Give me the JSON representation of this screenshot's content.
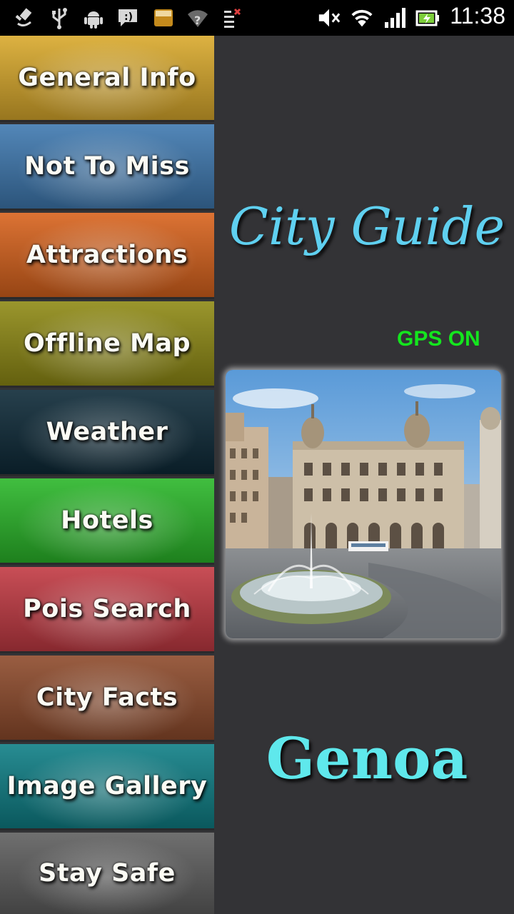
{
  "status_bar": {
    "time": "11:38",
    "left_icons": [
      "satellite-icon",
      "usb-icon",
      "android-icon",
      "message-icon",
      "amazon-apps-icon",
      "wifi-question-icon",
      "task-list-icon"
    ],
    "right_icons": [
      "mute-icon",
      "wifi-icon",
      "signal-icon",
      "battery-charging-icon"
    ]
  },
  "menu": {
    "items": [
      {
        "label": "General Info",
        "color": "#d9a92c"
      },
      {
        "label": "Not To Miss",
        "color": "#3f79b0"
      },
      {
        "label": "Attractions",
        "color": "#d8631d"
      },
      {
        "label": "Offline Map",
        "color": "#8f8a15"
      },
      {
        "label": "Weather",
        "color": "#0e2a38"
      },
      {
        "label": "Hotels",
        "color": "#2bb72a"
      },
      {
        "label": "Pois Search",
        "color": "#c23a43"
      },
      {
        "label": "City Facts",
        "color": "#8e4b2c"
      },
      {
        "label": "Image Gallery",
        "color": "#0f7f86"
      },
      {
        "label": "Stay Safe",
        "color": "#5f5f5f"
      }
    ]
  },
  "main": {
    "title": "City Guide",
    "gps_status": "GPS ON",
    "city_name": "Genoa",
    "colors": {
      "title": "#5fd0f0",
      "gps": "#14e61e",
      "city_name": "#5fe8ec",
      "background": "#333336"
    }
  }
}
